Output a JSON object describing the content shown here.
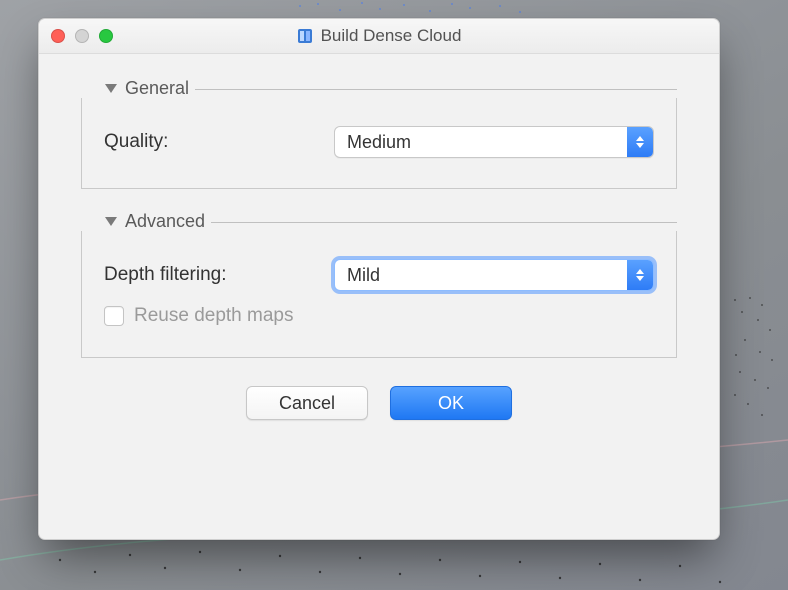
{
  "window": {
    "title": "Build Dense Cloud"
  },
  "sections": {
    "general": {
      "title": "General",
      "quality_label": "Quality:",
      "quality_value": "Medium"
    },
    "advanced": {
      "title": "Advanced",
      "depth_label": "Depth filtering:",
      "depth_value": "Mild",
      "reuse_label": "Reuse depth maps",
      "reuse_checked": false
    }
  },
  "buttons": {
    "cancel": "Cancel",
    "ok": "OK"
  }
}
